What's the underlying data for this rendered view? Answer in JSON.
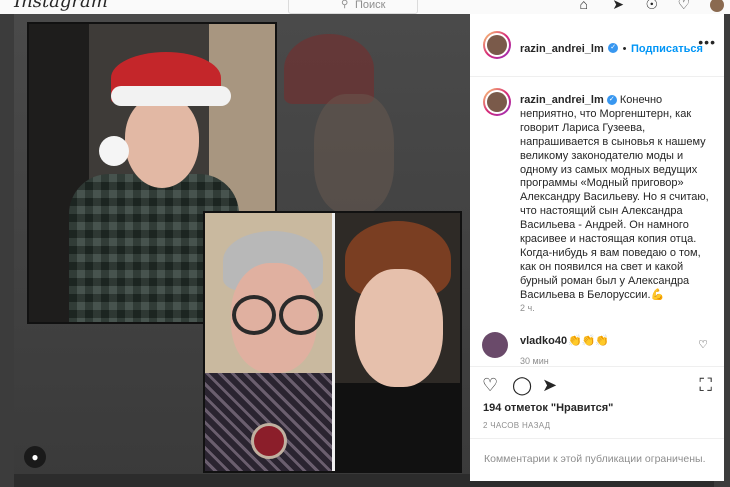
{
  "topbar": {
    "logo": "Instagram",
    "search_placeholder": "Поиск",
    "icons": [
      "home-icon",
      "direct-icon",
      "explore-icon",
      "heart-icon",
      "profile-avatar"
    ]
  },
  "post": {
    "username": "razin_andrei_lm",
    "follow_label": "Подписаться",
    "more_label": "•••",
    "caption": "Конечно неприятно, что Моргенштерн, как говорит Лариса Гузеева, напрашивается в сыновья к нашему великому законодателю моды и одному из самых модных ведущих программы «Модный приговор» Александру Васильеву. Но я считаю, что настоящий сын Александра Васильева - Андрей. Он намного красивее и настоящая копия отца. Когда-нибудь я вам поведаю о том, как он появился на свет и какой бурный роман был у Александра Васильева в Белоруссии.💪",
    "caption_time": "2 ч.",
    "comment": {
      "username": "vladko40",
      "text": "👏👏👏",
      "time": "30 мин"
    },
    "likes": "194 отметок \"Нравится\"",
    "date": "2 ЧАСОВ НАЗАД",
    "comments_limited": "Комментарии к этой публикации ограничены."
  },
  "colors": {
    "accent": "#0095f6",
    "verified": "#3897f0",
    "overlay": "#3c3c3c"
  }
}
